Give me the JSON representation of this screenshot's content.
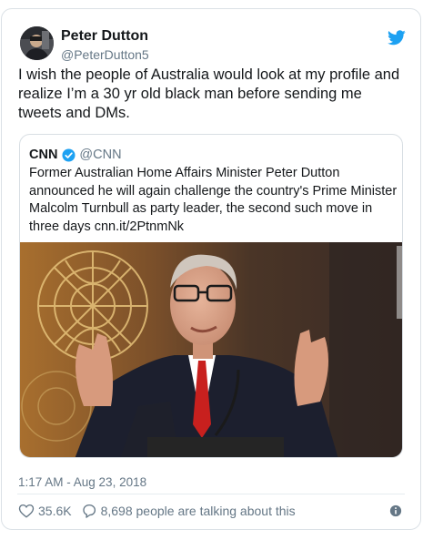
{
  "author": {
    "name": "Peter Dutton",
    "handle": "@PeterDutton5"
  },
  "tweet": {
    "text": "I wish the people of Australia would look at my profile and realize I’m a 30 yr old black man before sending me tweets and DMs.",
    "timestamp": "1:17 AM - Aug 23, 2018"
  },
  "quoted": {
    "name": "CNN",
    "handle": "@CNN",
    "text": "Former Australian Home Affairs Minister Peter Dutton announced he will again challenge the country's Prime Minister Malcolm Turnbull as party leader, the second such move in three days cnn.it/2PtnmNk"
  },
  "stats": {
    "likes": "35.6K",
    "talking": "8,698 people are talking about this"
  },
  "icons": {
    "logo": "twitter-bird-icon",
    "verified": "verified-badge-icon",
    "like": "heart-icon",
    "reply": "speech-bubble-icon",
    "info": "info-icon"
  },
  "colors": {
    "twitter_blue": "#1da1f2",
    "secondary_text": "#657786",
    "primary_text": "#14171a"
  }
}
